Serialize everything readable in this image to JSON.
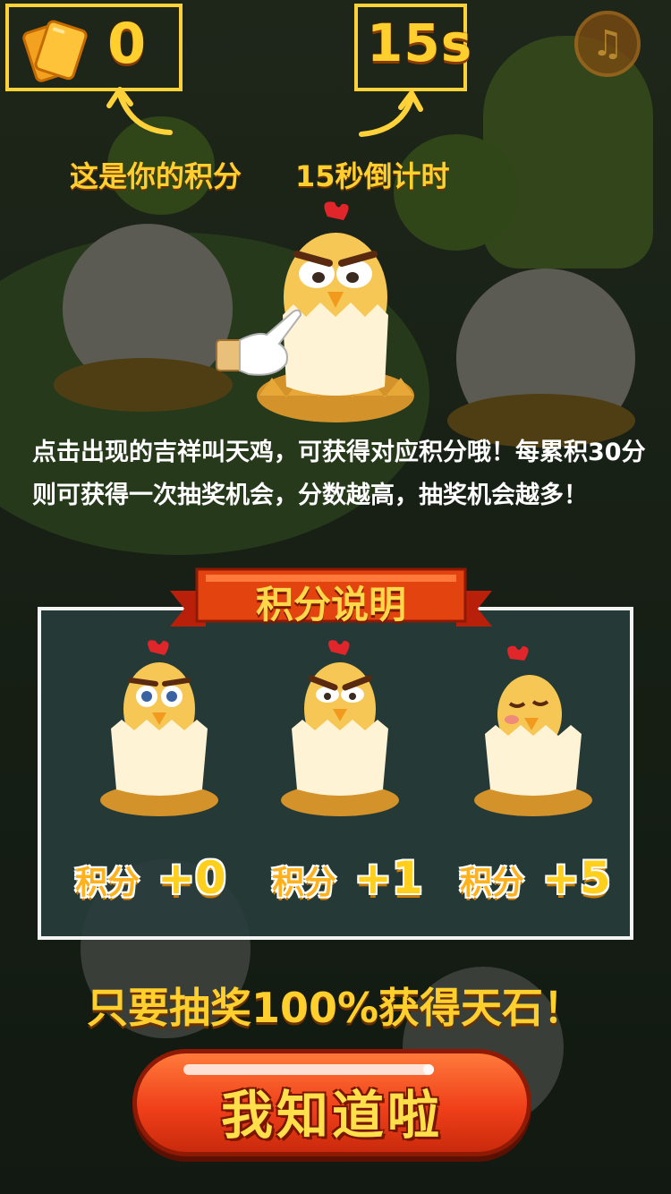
{
  "hud": {
    "score_value": "0",
    "timer_value": "15s",
    "score_hint": "这是你的积分",
    "timer_hint": "15秒倒计时"
  },
  "music_button": {
    "icon": "music-note-icon",
    "glyph": "♫"
  },
  "instructions": "点击出现的吉祥叫天鸡，可获得对应积分哦！每累积30分则可获得一次抽奖机会，分数越高，抽奖机会越多！",
  "scoring": {
    "title": "积分说明",
    "items": [
      {
        "chick": "surprised-chick",
        "label": "积分",
        "value": "+0"
      },
      {
        "chick": "angry-chick",
        "label": "积分",
        "value": "+1"
      },
      {
        "chick": "sleepy-chick",
        "label": "积分",
        "value": "+5"
      }
    ]
  },
  "promo": "只要抽奖100%获得天石！",
  "cta": {
    "label": "我知道啦"
  },
  "colors": {
    "accent_yellow": "#ffcf2e",
    "cta_red": "#f0401a",
    "panel_bg": "#283e3c"
  }
}
